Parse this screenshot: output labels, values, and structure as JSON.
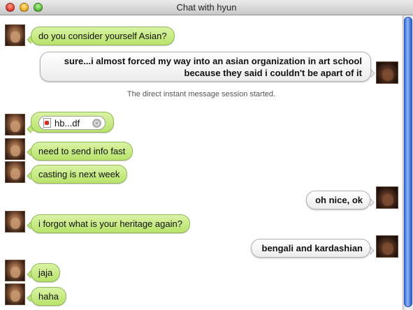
{
  "window": {
    "title": "Chat with hyun"
  },
  "status_message": "The direct instant message session started.",
  "attachment": {
    "file_name": "hb...df",
    "icon": "pdf-icon"
  },
  "messages": [
    {
      "from": "hyun",
      "text": "do you consider yourself Asian?"
    },
    {
      "from": "me",
      "line1": "sure...i almost forced my way into an asian organization in art school",
      "line2": "because they said i couldn't be apart of it"
    },
    {
      "from": "hyun",
      "text": "need to send info fast"
    },
    {
      "from": "hyun",
      "text": "casting is next week"
    },
    {
      "from": "me",
      "text": "oh nice, ok"
    },
    {
      "from": "hyun",
      "text": "i forgot what is your heritage again?"
    },
    {
      "from": "me",
      "text": "bengali and kardashian"
    },
    {
      "from": "hyun",
      "text": "jaja"
    },
    {
      "from": "hyun",
      "text": "haha"
    }
  ]
}
